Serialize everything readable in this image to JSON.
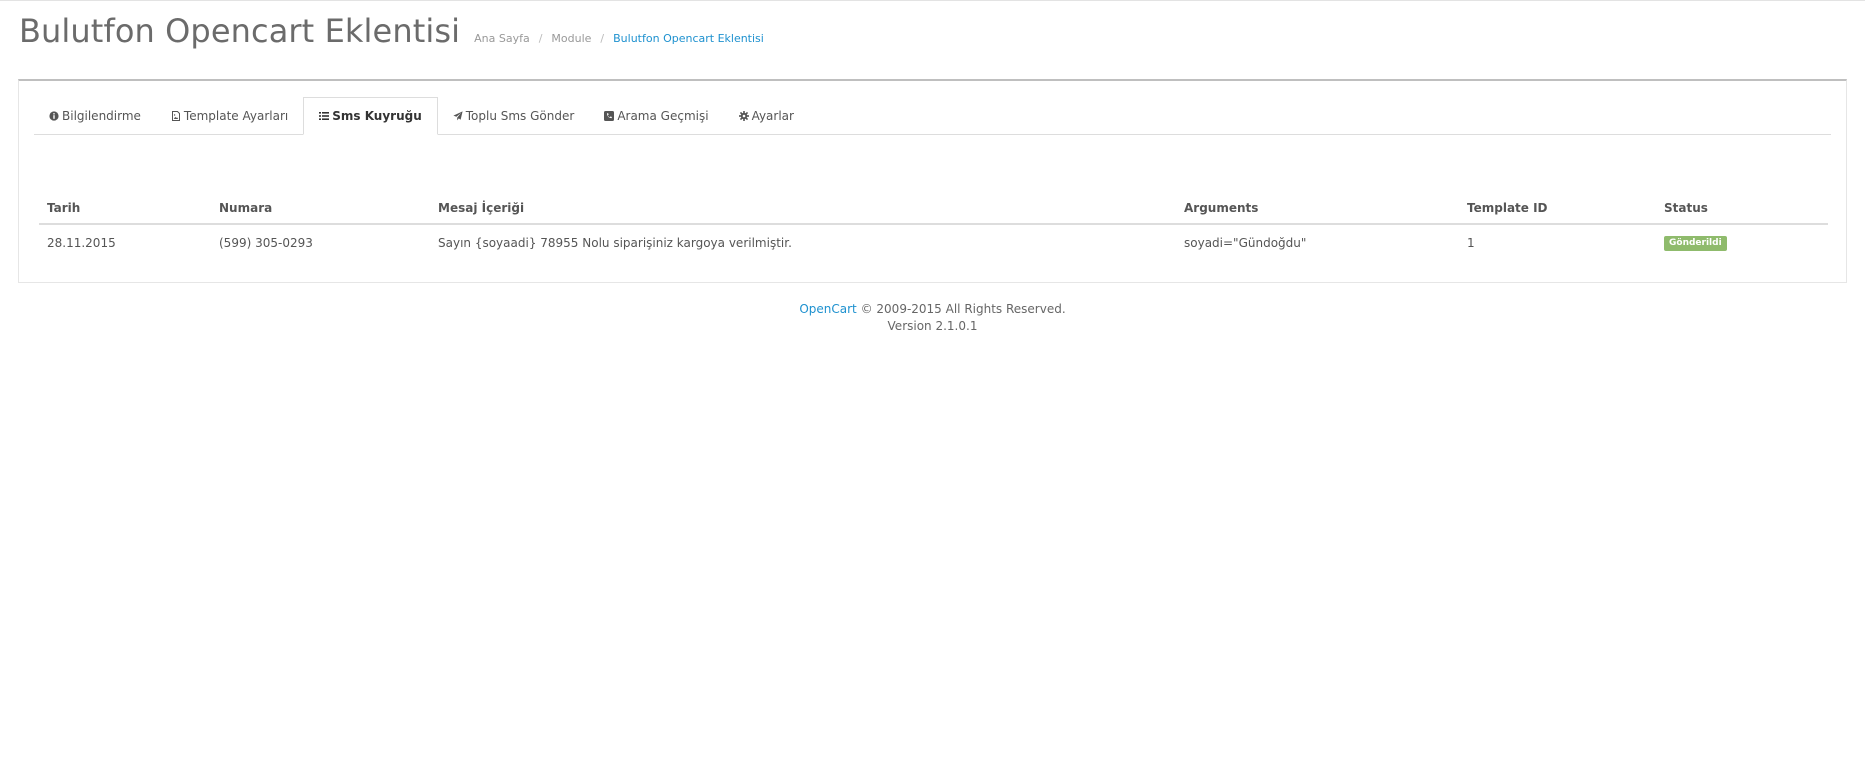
{
  "header": {
    "title": "Bulutfon Opencart Eklentisi",
    "breadcrumb": [
      {
        "label": "Ana Sayfa"
      },
      {
        "label": "Module"
      },
      {
        "label": "Bulutfon Opencart Eklentisi"
      }
    ],
    "breadcrumb_separator": "/",
    "link_color": "#1e91cf"
  },
  "tabs": [
    {
      "label": "Bilgilendirme",
      "icon": "info-circle-icon",
      "active": false
    },
    {
      "label": "Template Ayarları",
      "icon": "file-image-icon",
      "active": false
    },
    {
      "label": "Sms Kuyruğu",
      "icon": "list-icon",
      "active": true
    },
    {
      "label": "Toplu Sms Gönder",
      "icon": "paper-plane-icon",
      "active": false
    },
    {
      "label": "Arama Geçmişi",
      "icon": "phone-square-icon",
      "active": false
    },
    {
      "label": "Ayarlar",
      "icon": "gear-icon",
      "active": false
    }
  ],
  "table": {
    "columns": [
      "Tarih",
      "Numara",
      "Mesaj İçeriği",
      "Arguments",
      "Template ID",
      "Status"
    ],
    "rows": [
      {
        "tarih": "28.11.2015",
        "numara": "(599) 305-0293",
        "mesaj": "Sayın {soyaadi} 78955 Nolu siparişiniz kargoya verilmiştir.",
        "arguments": "soyadi=\"Gündoğdu\"",
        "template_id": "1",
        "status": "Gönderildi",
        "status_color": "#8fbb6c"
      }
    ]
  },
  "footer": {
    "link": "OpenCart",
    "copyright": "© 2009-2015 All Rights Reserved.",
    "version": "Version 2.1.0.1"
  }
}
